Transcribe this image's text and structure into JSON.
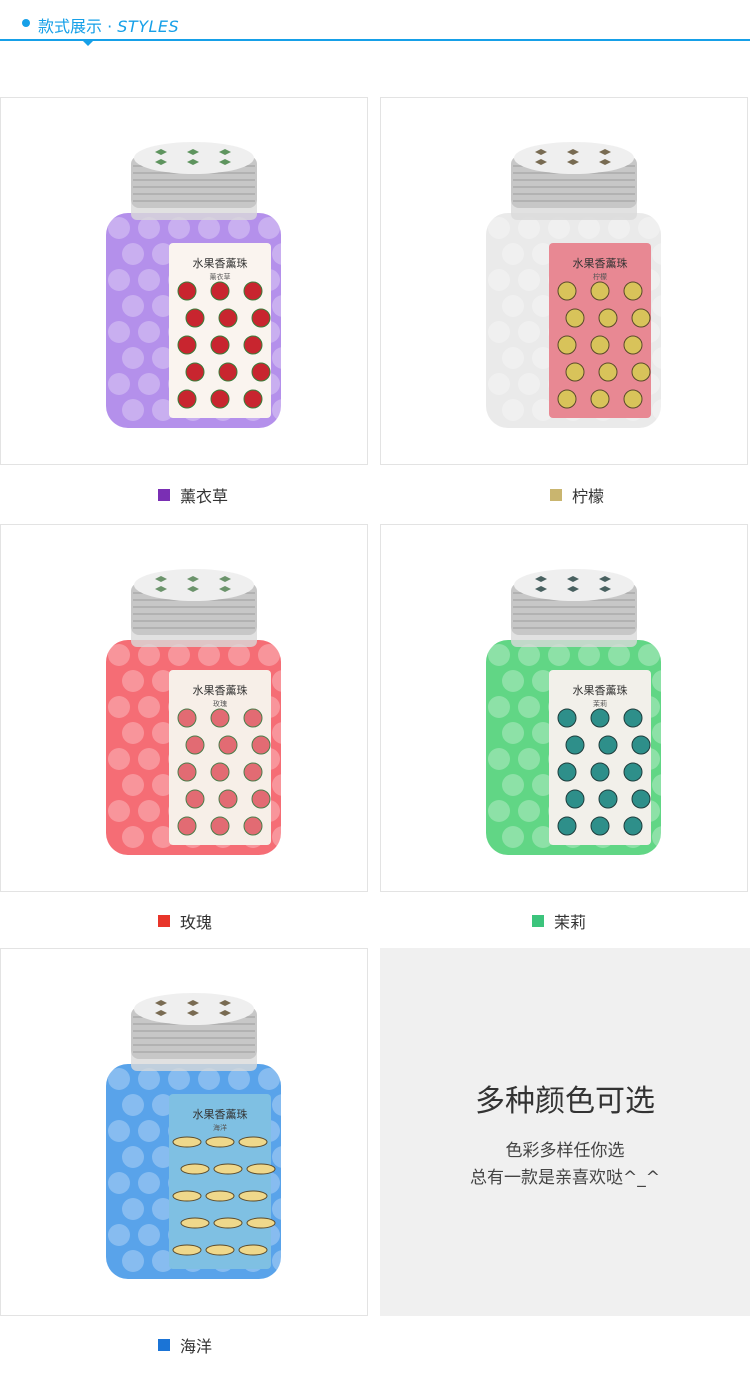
{
  "header": {
    "title_cn": "款式展示 · ",
    "title_en": "STYLES",
    "accent": "#16a0e8"
  },
  "products": [
    {
      "name": "薰衣草",
      "swatch": "#7a2fb4",
      "jar_color": "#a77ce8",
      "label_text": "水果香薰珠",
      "label_sub": "薰衣草",
      "pattern": "cherry"
    },
    {
      "name": "柠檬",
      "swatch": "#c9b56f",
      "jar_color": "#e6e6e6",
      "label_text": "水果香薰珠",
      "label_sub": "柠檬",
      "pattern": "lemon"
    },
    {
      "name": "玫瑰",
      "swatch": "#e8352a",
      "jar_color": "#f3545d",
      "label_text": "水果香薰珠",
      "label_sub": "玫瑰",
      "pattern": "strawberry"
    },
    {
      "name": "茉莉",
      "swatch": "#3cc47c",
      "jar_color": "#45cf70",
      "label_text": "水果香薰珠",
      "label_sub": "茉莉",
      "pattern": "watermelon"
    },
    {
      "name": "海洋",
      "swatch": "#1b74d6",
      "jar_color": "#3c93e6",
      "label_text": "水果香薰珠",
      "label_sub": "海洋",
      "pattern": "banana"
    }
  ],
  "promo": {
    "heading": "多种颜色可选",
    "line1": "色彩多样任你选",
    "line2": "总有一款是亲喜欢哒^_^"
  }
}
